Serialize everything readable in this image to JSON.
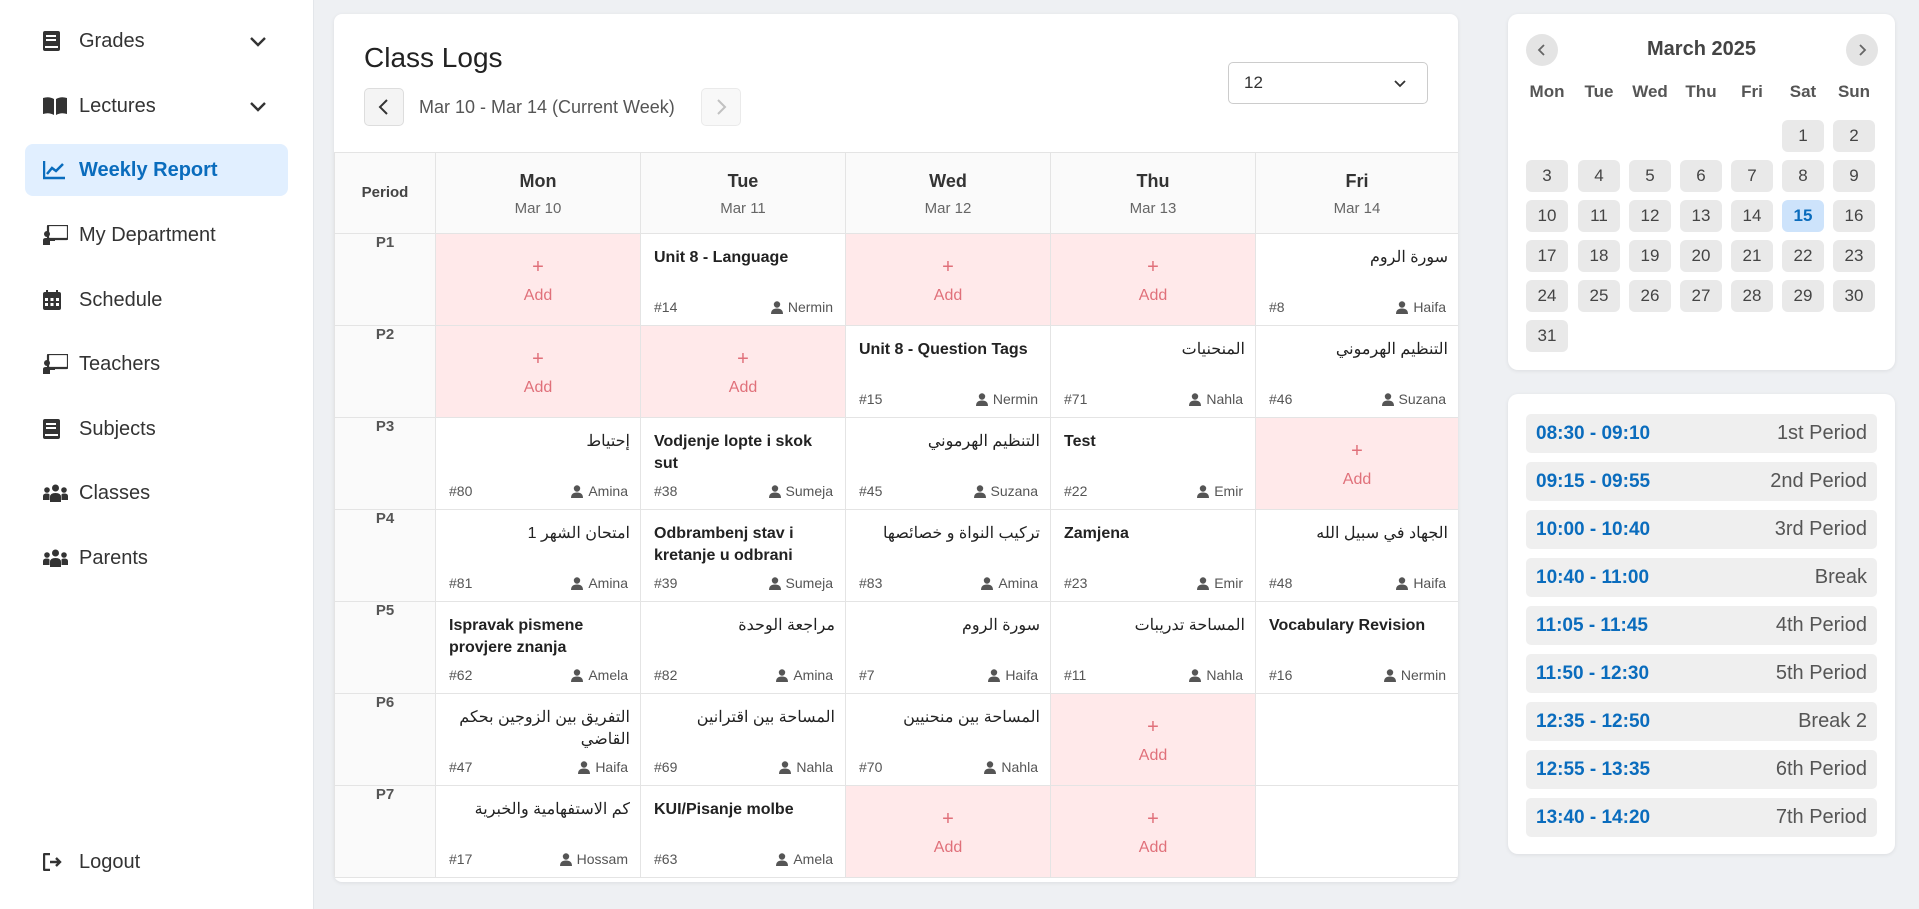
{
  "sidebar": {
    "items": [
      {
        "label": "Grades",
        "icon": "book-icon",
        "has_chevron": true
      },
      {
        "label": "Lectures",
        "icon": "open-book-icon",
        "has_chevron": true
      },
      {
        "label": "Weekly Report",
        "icon": "line-chart-icon",
        "active": true
      },
      {
        "label": "My Department",
        "icon": "presentation-icon"
      },
      {
        "label": "Schedule",
        "icon": "calendar-icon"
      },
      {
        "label": "Teachers",
        "icon": "presentation-icon"
      },
      {
        "label": "Subjects",
        "icon": "book-icon"
      },
      {
        "label": "Classes",
        "icon": "users-icon"
      },
      {
        "label": "Parents",
        "icon": "users-icon"
      }
    ],
    "logout_label": "Logout"
  },
  "main": {
    "title": "Class Logs",
    "week_label": "Mar 10 - Mar 14 (Current Week)",
    "class_select": "12",
    "period_header": "Period",
    "add_label": "Add",
    "add_symbol": "+",
    "days": [
      {
        "name": "Mon",
        "date": "Mar 10"
      },
      {
        "name": "Tue",
        "date": "Mar 11"
      },
      {
        "name": "Wed",
        "date": "Mar 12"
      },
      {
        "name": "Thu",
        "date": "Mar 13"
      },
      {
        "name": "Fri",
        "date": "Mar 14"
      }
    ],
    "rows": [
      {
        "period": "P1",
        "cells": [
          {
            "type": "empty"
          },
          {
            "type": "entry",
            "title": "Unit 8 - Language",
            "num": "#14",
            "teacher": "Nermin"
          },
          {
            "type": "empty"
          },
          {
            "type": "empty"
          },
          {
            "type": "entry",
            "title": "سورة الروم",
            "num": "#8",
            "teacher": "Haifa",
            "rtl": true
          }
        ]
      },
      {
        "period": "P2",
        "cells": [
          {
            "type": "empty"
          },
          {
            "type": "empty"
          },
          {
            "type": "entry",
            "title": "Unit 8 - Question Tags",
            "num": "#15",
            "teacher": "Nermin"
          },
          {
            "type": "entry",
            "title": "المنحنيات",
            "num": "#71",
            "teacher": "Nahla",
            "rtl": true
          },
          {
            "type": "entry",
            "title": "التنظيم الهرموني",
            "num": "#46",
            "teacher": "Suzana",
            "rtl": true
          }
        ]
      },
      {
        "period": "P3",
        "cells": [
          {
            "type": "entry",
            "title": "إحتياط",
            "num": "#80",
            "teacher": "Amina",
            "rtl": true
          },
          {
            "type": "entry",
            "title": "Vodjenje lopte i skok sut",
            "num": "#38",
            "teacher": "Sumeja"
          },
          {
            "type": "entry",
            "title": "التنظيم الهرموني",
            "num": "#45",
            "teacher": "Suzana",
            "rtl": true
          },
          {
            "type": "entry",
            "title": "Test",
            "num": "#22",
            "teacher": "Emir"
          },
          {
            "type": "empty"
          }
        ]
      },
      {
        "period": "P4",
        "cells": [
          {
            "type": "entry",
            "title": "امتحان الشهر 1",
            "num": "#81",
            "teacher": "Amina",
            "rtl": true
          },
          {
            "type": "entry",
            "title": "Odbrambenj stav i kretanje u odbrani",
            "num": "#39",
            "teacher": "Sumeja"
          },
          {
            "type": "entry",
            "title": "تركيب النواة و خصائصها",
            "num": "#83",
            "teacher": "Amina",
            "rtl": true
          },
          {
            "type": "entry",
            "title": "Zamjena",
            "num": "#23",
            "teacher": "Emir"
          },
          {
            "type": "entry",
            "title": "الجهاد في سبيل الله",
            "num": "#48",
            "teacher": "Haifa",
            "rtl": true
          }
        ]
      },
      {
        "period": "P5",
        "cells": [
          {
            "type": "entry",
            "title": "Ispravak pismene provjere znanja",
            "num": "#62",
            "teacher": "Amela"
          },
          {
            "type": "entry",
            "title": "مراجعة الوحدة",
            "num": "#82",
            "teacher": "Amina",
            "rtl": true
          },
          {
            "type": "entry",
            "title": "سورة الروم",
            "num": "#7",
            "teacher": "Haifa",
            "rtl": true
          },
          {
            "type": "entry",
            "title": "المساحة تدريبات",
            "num": "#11",
            "teacher": "Nahla",
            "rtl": true
          },
          {
            "type": "entry",
            "title": "Vocabulary Revision",
            "num": "#16",
            "teacher": "Nermin"
          }
        ]
      },
      {
        "period": "P6",
        "cells": [
          {
            "type": "entry",
            "title": "التفريق بين الزوجين بحكم القاضي",
            "num": "#47",
            "teacher": "Haifa",
            "rtl": true
          },
          {
            "type": "entry",
            "title": "المساحة بين اقترانين",
            "num": "#69",
            "teacher": "Nahla",
            "rtl": true
          },
          {
            "type": "entry",
            "title": "المساحة بين منحنيين",
            "num": "#70",
            "teacher": "Nahla",
            "rtl": true
          },
          {
            "type": "empty"
          },
          {
            "type": "blank"
          }
        ]
      },
      {
        "period": "P7",
        "cells": [
          {
            "type": "entry",
            "title": "كم الاستفهامية والخبرية",
            "num": "#17",
            "teacher": "Hossam",
            "rtl": true
          },
          {
            "type": "entry",
            "title": "KUI/Pisanje molbe",
            "num": "#63",
            "teacher": "Amela"
          },
          {
            "type": "empty"
          },
          {
            "type": "empty"
          },
          {
            "type": "blank"
          }
        ]
      }
    ]
  },
  "calendar": {
    "title": "March 2025",
    "weekdays": [
      "Mon",
      "Tue",
      "Wed",
      "Thu",
      "Fri",
      "Sat",
      "Sun"
    ],
    "first_weekday_index": 5,
    "days_in_month": 31,
    "today": 15
  },
  "periods": [
    {
      "time": "08:30 - 09:10",
      "name": "1st Period"
    },
    {
      "time": "09:15 - 09:55",
      "name": "2nd Period"
    },
    {
      "time": "10:00 - 10:40",
      "name": "3rd Period"
    },
    {
      "time": "10:40 - 11:00",
      "name": "Break"
    },
    {
      "time": "11:05 - 11:45",
      "name": "4th Period"
    },
    {
      "time": "11:50 - 12:30",
      "name": "5th Period"
    },
    {
      "time": "12:35 - 12:50",
      "name": "Break 2"
    },
    {
      "time": "12:55 - 13:35",
      "name": "6th Period"
    },
    {
      "time": "13:40 - 14:20",
      "name": "7th Period"
    }
  ],
  "colors": {
    "accent": "#0a6cbd",
    "active_bg": "#e1efff",
    "empty_cell": "#ffe9ea",
    "add_text": "#e0707a"
  }
}
